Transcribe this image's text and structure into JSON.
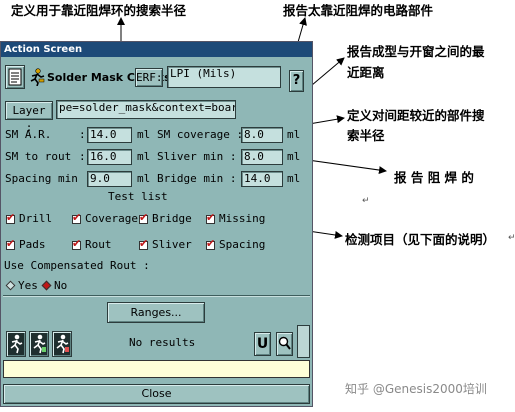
{
  "annotations": {
    "search_radius_near_plug": "定义用于靠近阻焊环的搜索半径",
    "report_parts_near_mask": "报告太靠近阻焊的电路部件",
    "report_min_distance_line1": "报告成型与开窗之间的最",
    "report_min_distance_line2": "近距离",
    "search_radius_near_parts_line1": "定义对间距较近的部件搜",
    "search_radius_near_parts_line2": "索半径",
    "report_solder_mask": "报 告 阻 焊 的",
    "test_items": "检测项目（见下面的说明）",
    "watermark": "知乎 @Genesis2000培训"
  },
  "dialog": {
    "title": "Action Screen",
    "action_name": "Solder Mask Checks",
    "erf_label": "ERF:",
    "erf_value": "LPI (Mils)",
    "help_label": "?",
    "layer_label": "Layer :",
    "layer_value": "pe=solder_mask&context=board",
    "params": {
      "sm_ar_label": "SM A.R.",
      "sm_ar_value": "14.0",
      "sm_coverage_label": "SM coverage :",
      "sm_coverage_value": "8.0",
      "sm_to_rout_label": "SM to rout",
      "sm_to_rout_value": "16.0",
      "sliver_min_label": "Sliver  min :",
      "sliver_min_value": "8.0",
      "spacing_min_label": "Spacing min :",
      "spacing_min_value": "9.0",
      "bridge_min_label": "Bridge  min :",
      "bridge_min_value": "14.0",
      "colon": ":",
      "unit": "ml"
    },
    "test_list_label": "Test list",
    "tests": [
      {
        "label": "Drill",
        "checked": true
      },
      {
        "label": "Coverage",
        "checked": true
      },
      {
        "label": "Bridge",
        "checked": true
      },
      {
        "label": "Missing",
        "checked": true
      },
      {
        "label": "Pads",
        "checked": true
      },
      {
        "label": "Rout",
        "checked": true
      },
      {
        "label": "Sliver",
        "checked": true
      },
      {
        "label": "Spacing",
        "checked": true
      }
    ],
    "compensated_label": "Use Compensated Rout :",
    "yes_label": "Yes",
    "no_label": "No",
    "compensated_selected": "No",
    "ranges_button": "Ranges...",
    "results_text": "No results",
    "close_button": "Close"
  }
}
